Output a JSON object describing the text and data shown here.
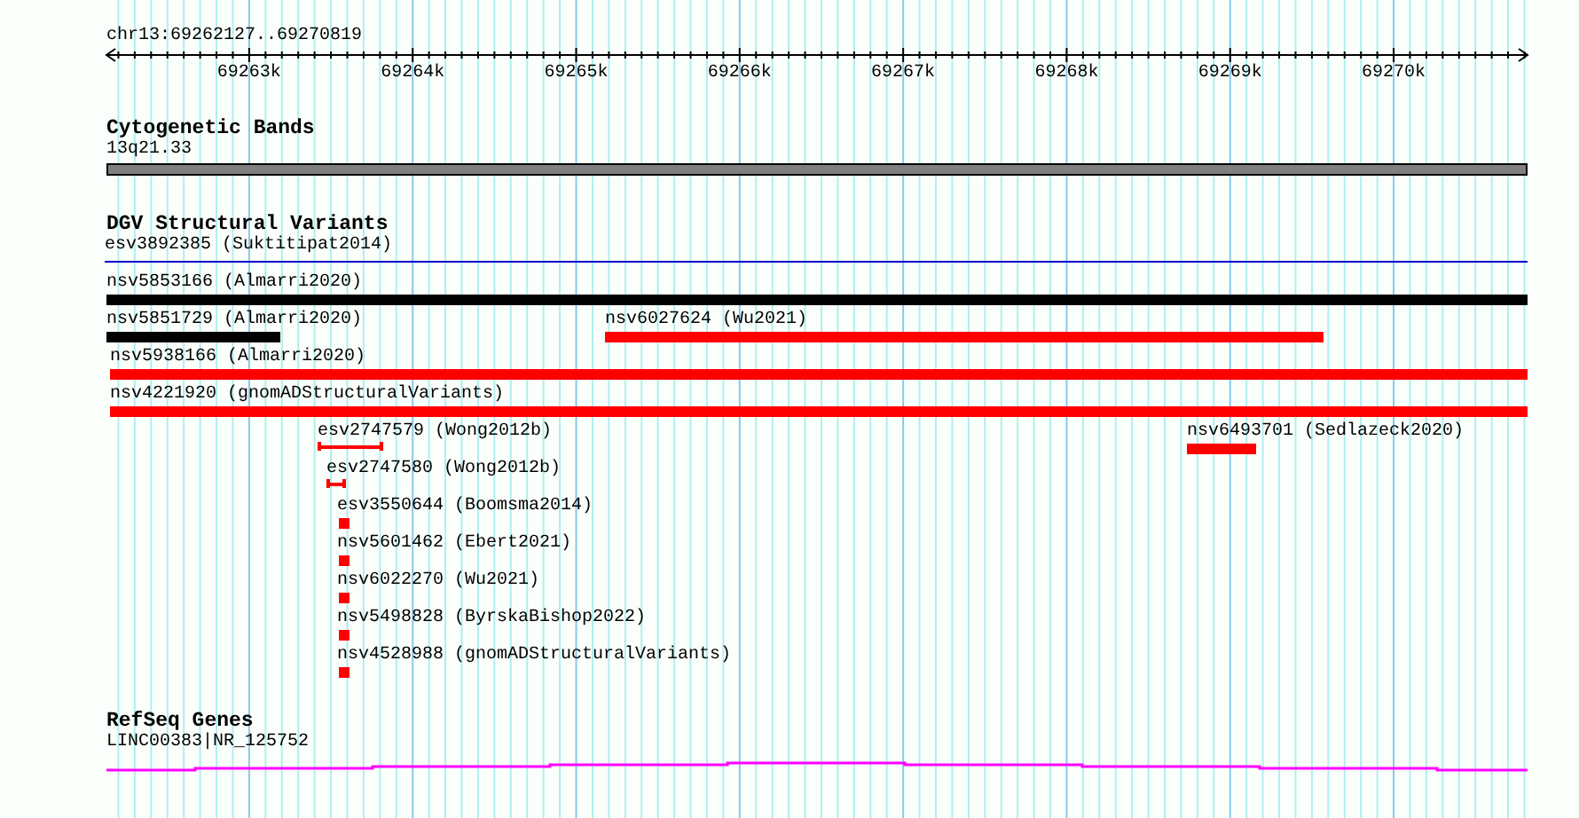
{
  "ruler": {
    "location": "chr13:69262127..69270819",
    "tick_labels": [
      "69263k",
      "69264k",
      "69265k",
      "69266k",
      "69267k",
      "69268k",
      "69269k",
      "69270k"
    ]
  },
  "tracks": [
    {
      "kind": "bands",
      "title": "Cytogenetic Bands",
      "label": "13q21.33"
    },
    {
      "kind": "variants",
      "title": "DGV Structural Variants",
      "rows": [
        [
          {
            "label": "esv3892385 (Suktitipat2014)",
            "kind": "line",
            "color": "#0000cc"
          }
        ],
        [
          {
            "label": "nsv5853166 (Almarri2020)",
            "kind": "bar",
            "color": "#000000"
          }
        ],
        [
          {
            "label": "nsv5851729 (Almarri2020)",
            "kind": "bar",
            "color": "#000000"
          },
          {
            "label": "nsv6027624 (Wu2021)",
            "kind": "bar",
            "color": "#ff0000"
          }
        ],
        [
          {
            "label": "nsv5938166 (Almarri2020)",
            "kind": "bar",
            "color": "#ff0000"
          }
        ],
        [
          {
            "label": "nsv4221920 (gnomADStructuralVariants)",
            "kind": "bar",
            "color": "#ff0000"
          }
        ],
        [
          {
            "label": "esv2747579 (Wong2012b)",
            "kind": "bracket",
            "color": "#ff0000"
          },
          {
            "label": "nsv6493701 (Sedlazeck2020)",
            "kind": "bar",
            "color": "#ff0000"
          }
        ],
        [
          {
            "label": "esv2747580 (Wong2012b)",
            "kind": "bracket",
            "color": "#ff0000"
          }
        ],
        [
          {
            "label": "esv3550644 (Boomsma2014)",
            "kind": "box",
            "color": "#ff0000"
          }
        ],
        [
          {
            "label": "nsv5601462 (Ebert2021)",
            "kind": "box",
            "color": "#ff0000"
          }
        ],
        [
          {
            "label": "nsv6022270 (Wu2021)",
            "kind": "box",
            "color": "#ff0000"
          }
        ],
        [
          {
            "label": "nsv5498828 (ByrskaBishop2022)",
            "kind": "box",
            "color": "#ff0000"
          }
        ],
        [
          {
            "label": "nsv4528988 (gnomADStructuralVariants)",
            "kind": "box",
            "color": "#ff0000"
          }
        ]
      ]
    },
    {
      "kind": "genes",
      "title": "RefSeq Genes",
      "label": "LINC00383|NR_125752"
    }
  ]
}
